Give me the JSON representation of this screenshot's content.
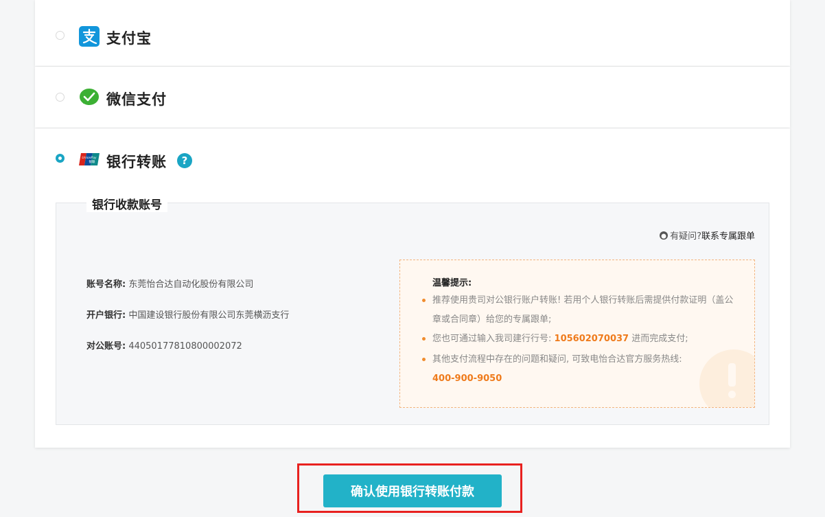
{
  "payment_options": {
    "alipay": {
      "label": "支付宝"
    },
    "wechat": {
      "label": "微信支付"
    },
    "bank": {
      "label": "银行转账",
      "help": "?"
    }
  },
  "bank_account": {
    "legend": "银行收款账号",
    "contact_prefix": "有疑问?",
    "contact_link": "联系专属跟单",
    "fields": [
      {
        "key": "账号名称:",
        "value": "东莞怡合达自动化股份有限公司"
      },
      {
        "key": "开户银行:",
        "value": "中国建设银行股份有限公司东莞横沥支行"
      },
      {
        "key": "对公账号:",
        "value": "44050177810800002072"
      }
    ]
  },
  "tips": {
    "title": "温馨提示:",
    "item1": "推荐使用贵司对公银行账户转账! 若用个人银行转账后需提供付款证明（盖公章或合同章）给您的专属跟单;",
    "item2_pre": "您也可通过输入我司建行行号:",
    "item2_code": "105602070037",
    "item2_post": "进而完成支付;",
    "item3": "其他支付流程中存在的问题和疑问, 可致电怡合达官方服务热线:",
    "hotline": "400-900-9050"
  },
  "confirm_button": "确认使用银行转账付款",
  "colors": {
    "accent": "#1aa5c4",
    "button": "#22b2c8",
    "highlight": "#ef7b1c",
    "alipay": "#1296db",
    "wechat": "#3cb034",
    "highlight_frame": "#e8211f"
  }
}
